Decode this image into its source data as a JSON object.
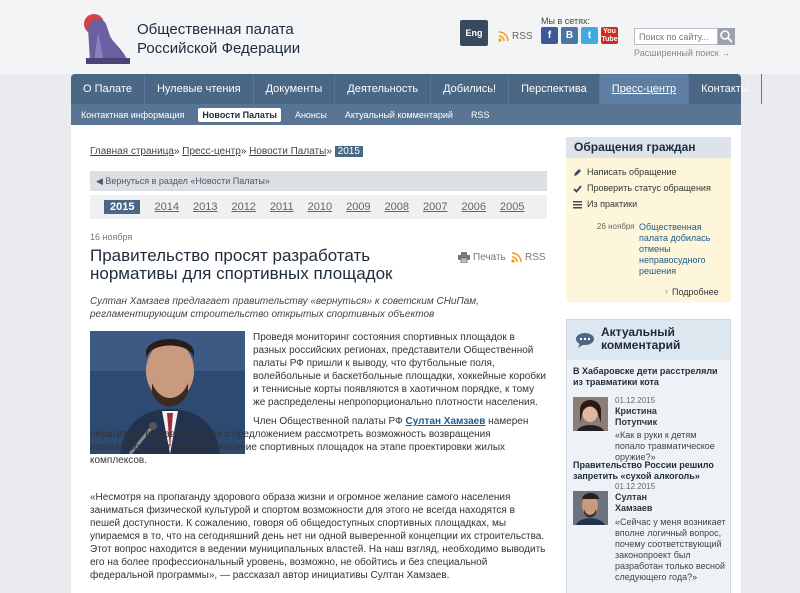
{
  "header": {
    "site_title_line1": "Общественная палата",
    "site_title_line2": "Российской Федерации",
    "lang_button": "Eng",
    "rss_label": "RSS",
    "social_label": "Мы в сетях:",
    "social": [
      {
        "label": "f",
        "icon": "facebook-icon"
      },
      {
        "label": "B",
        "icon": "vkontakte-icon"
      },
      {
        "label": "t",
        "icon": "twitter-icon"
      },
      {
        "label": "You Tube",
        "icon": "youtube-icon"
      }
    ],
    "search_placeholder": "Поиск по сайту...",
    "advanced_search": "Расширенный поиск →"
  },
  "nav": {
    "items": [
      "О Палате",
      "Нулевые чтения",
      "Документы",
      "Деятельность",
      "Добились!",
      "Перспектива",
      "Пресс-центр",
      "Контакты"
    ],
    "active_index": 6
  },
  "subnav": {
    "items": [
      "Контактная информация",
      "Новости Палаты",
      "Анонсы",
      "Актуальный комментарий",
      "RSS"
    ],
    "active_index": 1
  },
  "breadcrumb": {
    "home": "Главная страница",
    "press": "Пресс-центр",
    "news": "Новости Палаты",
    "current": "2015",
    "separator": "»"
  },
  "back_link": "◀ Вернуться в раздел «Новости Палаты»",
  "years": [
    "2015",
    "2014",
    "2013",
    "2012",
    "2011",
    "2010",
    "2009",
    "2008",
    "2007",
    "2006",
    "2005"
  ],
  "article": {
    "date": "16 ноября",
    "title": "Правительство просят разработать нормативы для спортивных площадок",
    "print_label": "Печать",
    "rss_label": "RSS",
    "lead": "Султан Хамзаев предлагает правительству «вернуться» к советским СНиПам, регламентирующим строительство открытых спортивных объектов",
    "p1": "Проведя мониторинг состояния спортивных площадок в разных российских регионах, представители Общественной палаты РФ пришли к выводу, что футбольные поля, волейбольные и баскетбольные площадки, хоккейные коробки и теннисные корты появляются в хаотичном порядке, к тому же распределены непропорционально плотности населения.",
    "p2_before": "Член Общественной палаты РФ ",
    "p2_person": "Султан Хамзаев",
    "p2_after": " намерен обратиться в правительство с предложением рассмотреть возможность возвращения нормативов, учитывающих наличие спортивных площадок на этапе проектировки жилых комплексов.",
    "p3": "«Несмотря на пропаганду здорового образа жизни и огромное желание самого населения заниматься физической культурой и спортом возможности для этого не всегда находятся в пешей доступности. К сожалению, говоря об общедоступных спортивных площадках, мы упираемся в то, что на сегодняшний день нет ни одной выверенной концепции их строительства. Этот вопрос находится в ведении муниципальных властей. На наш взгляд, необходимо выводить его на более профессиональный уровень, возможно, не обойтись и без специальной федеральной программы», — рассказал автор инициативы Султан Хамзаев."
  },
  "appeals": {
    "title": "Обращения граждан",
    "items": [
      {
        "label": "Написать обращение",
        "icon": "pencil-icon"
      },
      {
        "label": "Проверить статус обращения",
        "icon": "check-icon"
      },
      {
        "label": "Из практики",
        "icon": "list-icon"
      }
    ],
    "news_date": "26 ноября",
    "news_text": "Общественная палата добилась отмены неправосудного решения",
    "more": "Подробнее"
  },
  "comments": {
    "title_line1": "Актуальный",
    "title_line2": "комментарий",
    "blocks": [
      {
        "headline": "В Хабаровске дети расстреляли из травматики кота",
        "date": "01.12.2015",
        "name_line1": "Кристина",
        "name_line2": "Потупчик",
        "quote": "«Как в руки к детям попало травматическое оружие?»"
      },
      {
        "headline": "Правительство России решило запретить «сухой алкоголь»",
        "date": "01.12.2015",
        "name_line1": "Султан",
        "name_line2": "Хамзаев",
        "quote": "«Сейчас у меня возникает вполне логичный вопрос, почему соответствующий законопроект был разработан только весной следующего года?»"
      }
    ]
  },
  "colors": {
    "nav_bg": "#4a6785",
    "accent_link": "#1f5b8c",
    "appeals_bg": "#fdf6da"
  }
}
